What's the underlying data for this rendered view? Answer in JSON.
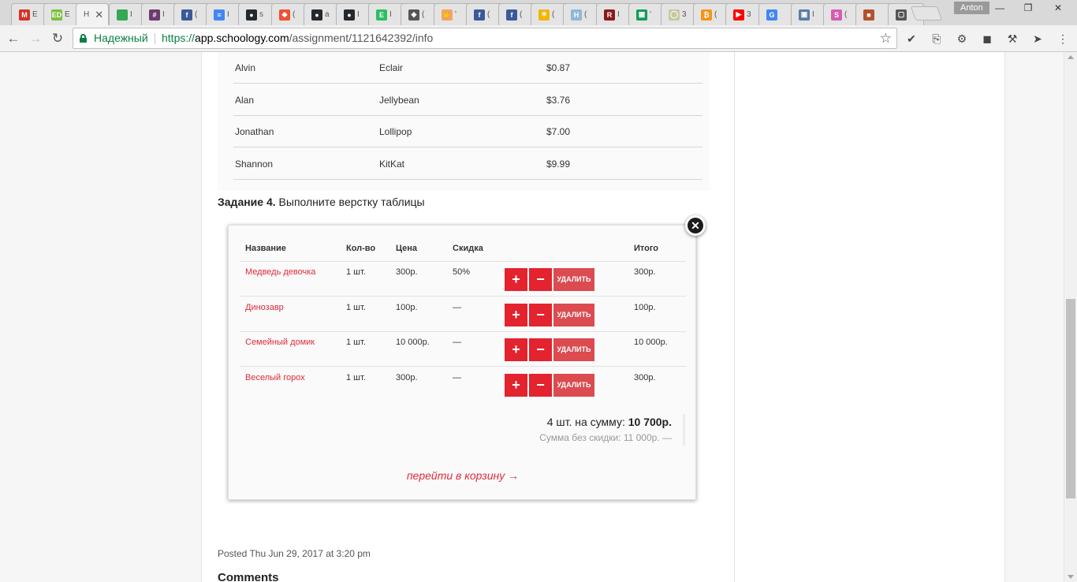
{
  "browser": {
    "tabs": [
      {
        "icon": "gmail-icon",
        "letter": "M",
        "label": "E",
        "color": "#d93025"
      },
      {
        "icon": "classroom-icon",
        "letter": "ED",
        "label": "E",
        "color": "#7cbf3c"
      },
      {
        "icon": "schoology-icon",
        "letter": "",
        "label": "H",
        "color": "#1b5fab",
        "active": true
      },
      {
        "icon": "drive-icon",
        "letter": "",
        "label": "I",
        "color": "#34a853"
      },
      {
        "icon": "slack-icon",
        "letter": "#",
        "label": "I",
        "color": "#6b3a6e"
      },
      {
        "icon": "facebook-icon",
        "letter": "f",
        "label": "(",
        "color": "#3b5998"
      },
      {
        "icon": "docs-icon",
        "letter": "≡",
        "label": "I",
        "color": "#4285f4"
      },
      {
        "icon": "github-icon",
        "letter": "●",
        "label": "s",
        "color": "#24292e"
      },
      {
        "icon": "git-icon",
        "letter": "◆",
        "label": "(",
        "color": "#f05032"
      },
      {
        "icon": "github-icon",
        "letter": "●",
        "label": "a",
        "color": "#24292e"
      },
      {
        "icon": "github-icon",
        "letter": "●",
        "label": "I",
        "color": "#24292e"
      },
      {
        "icon": "evernote-icon",
        "letter": "E",
        "label": "I",
        "color": "#2dbe60"
      },
      {
        "icon": "shield-icon",
        "letter": "◈",
        "label": "(",
        "color": "#555555"
      },
      {
        "icon": "hand-icon",
        "letter": "✋",
        "label": "'",
        "color": "#f4a460"
      },
      {
        "icon": "facebook-icon",
        "letter": "f",
        "label": "(",
        "color": "#3b5998"
      },
      {
        "icon": "facebook-icon",
        "letter": "f",
        "label": "(",
        "color": "#3b5998"
      },
      {
        "icon": "sun-icon",
        "letter": "☀",
        "label": "(",
        "color": "#f4b400"
      },
      {
        "icon": "h-icon",
        "letter": "H",
        "label": "(",
        "color": "#8fb8d8"
      },
      {
        "icon": "r-icon",
        "letter": "R",
        "label": "I",
        "color": "#8b1a1a"
      },
      {
        "icon": "sheets-icon",
        "letter": "▦",
        "label": "'",
        "color": "#0f9d58"
      },
      {
        "icon": "bulb-icon",
        "letter": "◯",
        "label": "3",
        "color": "#c8c8a0"
      },
      {
        "icon": "bitcoin-icon",
        "letter": "₿",
        "label": "(",
        "color": "#f7931a"
      },
      {
        "icon": "youtube-icon",
        "letter": "▶",
        "label": "3",
        "color": "#ff0000"
      },
      {
        "icon": "google-icon",
        "letter": "G",
        "label": "",
        "color": "#4285f4"
      },
      {
        "icon": "image-icon",
        "letter": "▣",
        "label": "I",
        "color": "#5a7aa8"
      },
      {
        "icon": "pink-icon",
        "letter": "S",
        "label": "(",
        "color": "#d65db1"
      },
      {
        "icon": "squares-icon",
        "letter": "■",
        "label": "",
        "color": "#b5512b"
      },
      {
        "icon": "chat-icon",
        "letter": "▢",
        "label": "",
        "color": "#555555"
      }
    ],
    "profile_name": "Anton",
    "window_controls": {
      "minimize": "—",
      "restore": "❐",
      "close": "✕"
    },
    "nav": {
      "back": "←",
      "forward": "→",
      "reload": "↻"
    },
    "omnibox": {
      "secure_label": "Надежный",
      "url_scheme": "https://",
      "url_host": "app.schoology.com",
      "url_path": "/assignment/1121642392/info",
      "bookmark_star": "☆"
    },
    "extensions": [
      {
        "icon": "check-icon",
        "glyph": "✔"
      },
      {
        "icon": "pdf-icon",
        "glyph": "⎘"
      },
      {
        "icon": "gear-icon",
        "glyph": "⚙"
      },
      {
        "icon": "gradient-icon",
        "glyph": "◼"
      },
      {
        "icon": "hammer-icon",
        "glyph": "⚒"
      },
      {
        "icon": "cursor-icon",
        "glyph": "➤"
      },
      {
        "icon": "menu-icon",
        "glyph": "⋮"
      }
    ]
  },
  "demo_table": {
    "rows": [
      {
        "name": "Alvin",
        "item": "Eclair",
        "price": "$0.87"
      },
      {
        "name": "Alan",
        "item": "Jellybean",
        "price": "$3.76"
      },
      {
        "name": "Jonathan",
        "item": "Lollipop",
        "price": "$7.00"
      },
      {
        "name": "Shannon",
        "item": "KitKat",
        "price": "$9.99"
      }
    ]
  },
  "task": {
    "label": "Задание 4.",
    "text": " Выполните верстку таблицы"
  },
  "cart": {
    "close_glyph": "✕",
    "headers": {
      "name": "Название",
      "qty": "Кол-во",
      "price": "Цена",
      "discount": "Скидка",
      "total": "Итого"
    },
    "rows": [
      {
        "name": "Медведь девочка",
        "qty": "1 шт.",
        "price": "300р.",
        "discount": "50%",
        "total": "300р."
      },
      {
        "name": "Динозавр",
        "qty": "1 шт.",
        "price": "100р.",
        "discount": "—",
        "total": "100р."
      },
      {
        "name": "Семейный домик",
        "qty": "1 шт.",
        "price": "10 000р.",
        "discount": "—",
        "total": "10 000р."
      },
      {
        "name": "Веселый горох",
        "qty": "1 шт.",
        "price": "300р.",
        "discount": "—",
        "total": "300р."
      }
    ],
    "plus_label": "+",
    "minus_label": "−",
    "delete_label": "УДАЛИТЬ",
    "summary_prefix": "4 шт. на сумму: ",
    "summary_total": "10 700р.",
    "summary_sub": "Сумма без скидки: 11 000р. —",
    "checkout_link": "перейти в корзину →",
    "accent_color": "#e3232e"
  },
  "footer": {
    "posted": "Posted Thu Jun 29, 2017 at 3:20 pm",
    "comments_heading": "Comments"
  }
}
